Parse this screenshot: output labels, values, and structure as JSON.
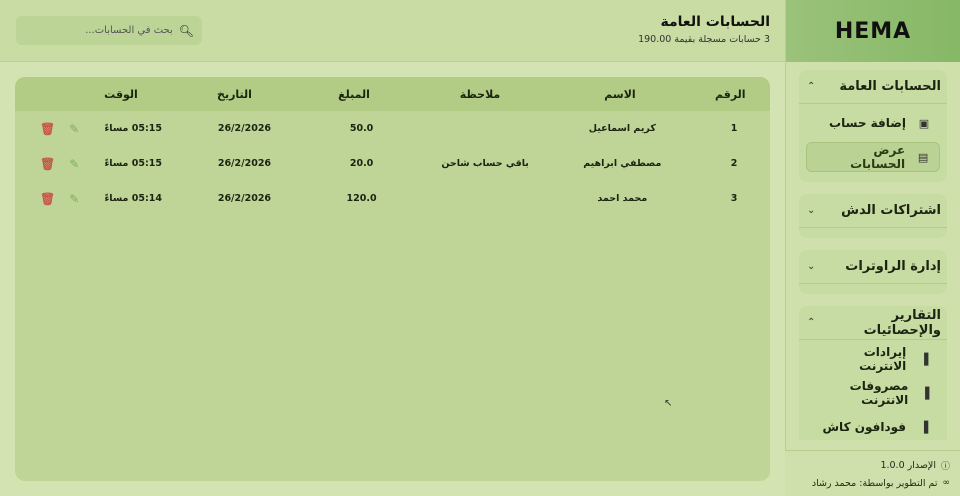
{
  "brand": "HEMA",
  "header": {
    "title": "الحسابات العامة",
    "subtitle": "3 حسابات مسجلة بقيمة 190.00",
    "search_placeholder": "بحث في الحسابات..."
  },
  "table": {
    "columns": [
      "الرقم",
      "الاسم",
      "ملاحظة",
      "المبلغ",
      "التاريخ",
      "الوقت"
    ],
    "rows": [
      {
        "num": "1",
        "name": "كريم اسماعيل",
        "note": "",
        "amount": "50.0",
        "date": "26/2/2026",
        "time": "05:15 مساءً"
      },
      {
        "num": "2",
        "name": "مصطفي ابراهيم",
        "note": "باقي حساب شاحن",
        "amount": "20.0",
        "date": "26/2/2026",
        "time": "05:15 مساءً"
      },
      {
        "num": "3",
        "name": "محمد احمد",
        "note": "",
        "amount": "120.0",
        "date": "26/2/2026",
        "time": "05:14 مساءً"
      }
    ]
  },
  "sidebar": {
    "sections": [
      {
        "title": "الحسابات العامة",
        "expanded": true,
        "items": [
          {
            "label": "إضافة حساب",
            "icon": "wallet-icon",
            "active": false
          },
          {
            "label": "عرض الحسابات",
            "icon": "table-icon",
            "active": true
          }
        ]
      },
      {
        "title": "اشتراكات الدش",
        "expanded": false,
        "items": []
      },
      {
        "title": "إدارة الراوترات",
        "expanded": false,
        "items": []
      },
      {
        "title": "التقارير والإحصائيات",
        "expanded": true,
        "items": [
          {
            "label": "إيرادات الانترنت",
            "icon": "bar-chart-icon",
            "active": false
          },
          {
            "label": "مصروفات الانترنت",
            "icon": "bar-chart-icon",
            "active": false
          },
          {
            "label": "فودافون كاش",
            "icon": "bar-chart-icon",
            "active": false
          }
        ]
      }
    ]
  },
  "footer": {
    "version": "الإصدار 1.0.0",
    "developer": "تم التطوير بواسطة: محمد رشاد"
  },
  "colors": {
    "accent": "#86b866",
    "edit": "#7cae55",
    "delete": "#c2594a"
  }
}
